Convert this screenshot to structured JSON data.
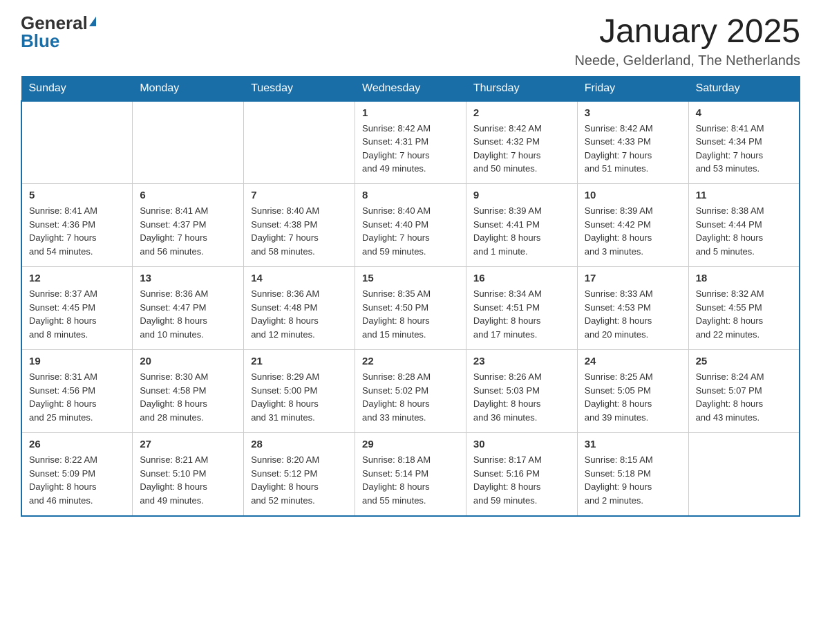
{
  "logo": {
    "general": "General",
    "blue": "Blue"
  },
  "title": "January 2025",
  "location": "Neede, Gelderland, The Netherlands",
  "days_of_week": [
    "Sunday",
    "Monday",
    "Tuesday",
    "Wednesday",
    "Thursday",
    "Friday",
    "Saturday"
  ],
  "weeks": [
    [
      {
        "day": "",
        "info": ""
      },
      {
        "day": "",
        "info": ""
      },
      {
        "day": "",
        "info": ""
      },
      {
        "day": "1",
        "info": "Sunrise: 8:42 AM\nSunset: 4:31 PM\nDaylight: 7 hours\nand 49 minutes."
      },
      {
        "day": "2",
        "info": "Sunrise: 8:42 AM\nSunset: 4:32 PM\nDaylight: 7 hours\nand 50 minutes."
      },
      {
        "day": "3",
        "info": "Sunrise: 8:42 AM\nSunset: 4:33 PM\nDaylight: 7 hours\nand 51 minutes."
      },
      {
        "day": "4",
        "info": "Sunrise: 8:41 AM\nSunset: 4:34 PM\nDaylight: 7 hours\nand 53 minutes."
      }
    ],
    [
      {
        "day": "5",
        "info": "Sunrise: 8:41 AM\nSunset: 4:36 PM\nDaylight: 7 hours\nand 54 minutes."
      },
      {
        "day": "6",
        "info": "Sunrise: 8:41 AM\nSunset: 4:37 PM\nDaylight: 7 hours\nand 56 minutes."
      },
      {
        "day": "7",
        "info": "Sunrise: 8:40 AM\nSunset: 4:38 PM\nDaylight: 7 hours\nand 58 minutes."
      },
      {
        "day": "8",
        "info": "Sunrise: 8:40 AM\nSunset: 4:40 PM\nDaylight: 7 hours\nand 59 minutes."
      },
      {
        "day": "9",
        "info": "Sunrise: 8:39 AM\nSunset: 4:41 PM\nDaylight: 8 hours\nand 1 minute."
      },
      {
        "day": "10",
        "info": "Sunrise: 8:39 AM\nSunset: 4:42 PM\nDaylight: 8 hours\nand 3 minutes."
      },
      {
        "day": "11",
        "info": "Sunrise: 8:38 AM\nSunset: 4:44 PM\nDaylight: 8 hours\nand 5 minutes."
      }
    ],
    [
      {
        "day": "12",
        "info": "Sunrise: 8:37 AM\nSunset: 4:45 PM\nDaylight: 8 hours\nand 8 minutes."
      },
      {
        "day": "13",
        "info": "Sunrise: 8:36 AM\nSunset: 4:47 PM\nDaylight: 8 hours\nand 10 minutes."
      },
      {
        "day": "14",
        "info": "Sunrise: 8:36 AM\nSunset: 4:48 PM\nDaylight: 8 hours\nand 12 minutes."
      },
      {
        "day": "15",
        "info": "Sunrise: 8:35 AM\nSunset: 4:50 PM\nDaylight: 8 hours\nand 15 minutes."
      },
      {
        "day": "16",
        "info": "Sunrise: 8:34 AM\nSunset: 4:51 PM\nDaylight: 8 hours\nand 17 minutes."
      },
      {
        "day": "17",
        "info": "Sunrise: 8:33 AM\nSunset: 4:53 PM\nDaylight: 8 hours\nand 20 minutes."
      },
      {
        "day": "18",
        "info": "Sunrise: 8:32 AM\nSunset: 4:55 PM\nDaylight: 8 hours\nand 22 minutes."
      }
    ],
    [
      {
        "day": "19",
        "info": "Sunrise: 8:31 AM\nSunset: 4:56 PM\nDaylight: 8 hours\nand 25 minutes."
      },
      {
        "day": "20",
        "info": "Sunrise: 8:30 AM\nSunset: 4:58 PM\nDaylight: 8 hours\nand 28 minutes."
      },
      {
        "day": "21",
        "info": "Sunrise: 8:29 AM\nSunset: 5:00 PM\nDaylight: 8 hours\nand 31 minutes."
      },
      {
        "day": "22",
        "info": "Sunrise: 8:28 AM\nSunset: 5:02 PM\nDaylight: 8 hours\nand 33 minutes."
      },
      {
        "day": "23",
        "info": "Sunrise: 8:26 AM\nSunset: 5:03 PM\nDaylight: 8 hours\nand 36 minutes."
      },
      {
        "day": "24",
        "info": "Sunrise: 8:25 AM\nSunset: 5:05 PM\nDaylight: 8 hours\nand 39 minutes."
      },
      {
        "day": "25",
        "info": "Sunrise: 8:24 AM\nSunset: 5:07 PM\nDaylight: 8 hours\nand 43 minutes."
      }
    ],
    [
      {
        "day": "26",
        "info": "Sunrise: 8:22 AM\nSunset: 5:09 PM\nDaylight: 8 hours\nand 46 minutes."
      },
      {
        "day": "27",
        "info": "Sunrise: 8:21 AM\nSunset: 5:10 PM\nDaylight: 8 hours\nand 49 minutes."
      },
      {
        "day": "28",
        "info": "Sunrise: 8:20 AM\nSunset: 5:12 PM\nDaylight: 8 hours\nand 52 minutes."
      },
      {
        "day": "29",
        "info": "Sunrise: 8:18 AM\nSunset: 5:14 PM\nDaylight: 8 hours\nand 55 minutes."
      },
      {
        "day": "30",
        "info": "Sunrise: 8:17 AM\nSunset: 5:16 PM\nDaylight: 8 hours\nand 59 minutes."
      },
      {
        "day": "31",
        "info": "Sunrise: 8:15 AM\nSunset: 5:18 PM\nDaylight: 9 hours\nand 2 minutes."
      },
      {
        "day": "",
        "info": ""
      }
    ]
  ]
}
